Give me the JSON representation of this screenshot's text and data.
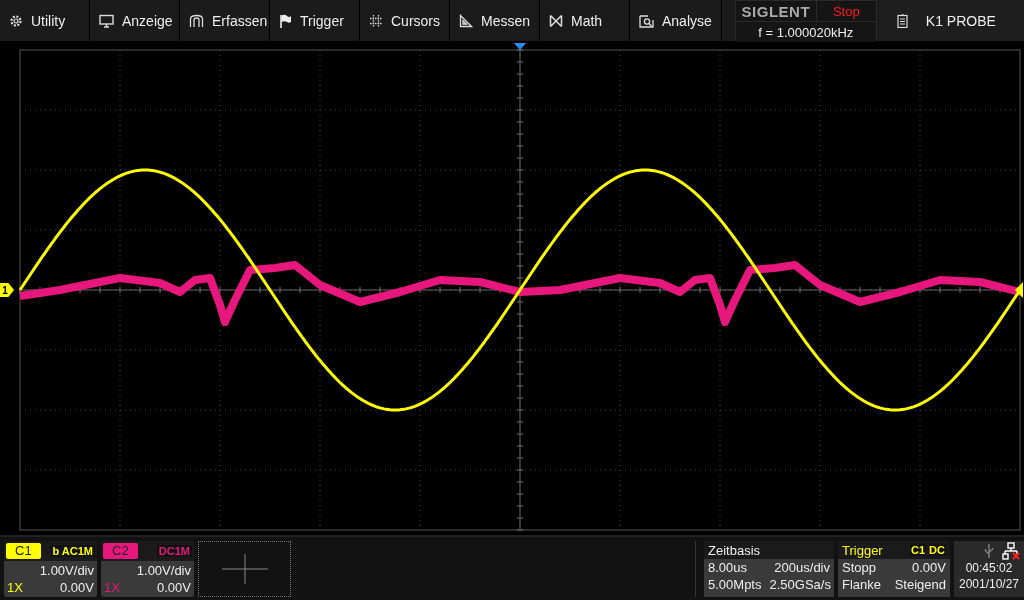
{
  "menu": [
    {
      "label": "Utility"
    },
    {
      "label": "Anzeige"
    },
    {
      "label": "Erfassen"
    },
    {
      "label": "Trigger"
    },
    {
      "label": "Cursors"
    },
    {
      "label": "Messen"
    },
    {
      "label": "Math"
    },
    {
      "label": "Analyse"
    }
  ],
  "brand": "SIGLENT",
  "run_status": "Stop",
  "frequency": "f = 1.000020kHz",
  "probe": "K1 PROBE",
  "channel_marker": "1",
  "channels": [
    {
      "name": "C1",
      "color": "#ffff00",
      "coupling": "b AC1M",
      "scale": "1.00V/div",
      "probe": "1X",
      "offset": "0.00V"
    },
    {
      "name": "C2",
      "color": "#e8177e",
      "coupling": "DC1M",
      "scale": "1.00V/div",
      "probe": "1X",
      "offset": "0.00V"
    }
  ],
  "timebase": {
    "title": "Zeitbasis",
    "delay": "8.00us",
    "scale": "200us/div",
    "points": "5.00Mpts",
    "rate": "2.50GSa/s"
  },
  "trigger": {
    "title": "Trigger",
    "source": "C1",
    "coupling": "DC",
    "mode": "Stopp",
    "trigger_level": "0.00V",
    "edge_type": "Flanke",
    "slope": "Steigend"
  },
  "clock": {
    "time": "00:45:02",
    "date": "2001/10/27"
  }
}
